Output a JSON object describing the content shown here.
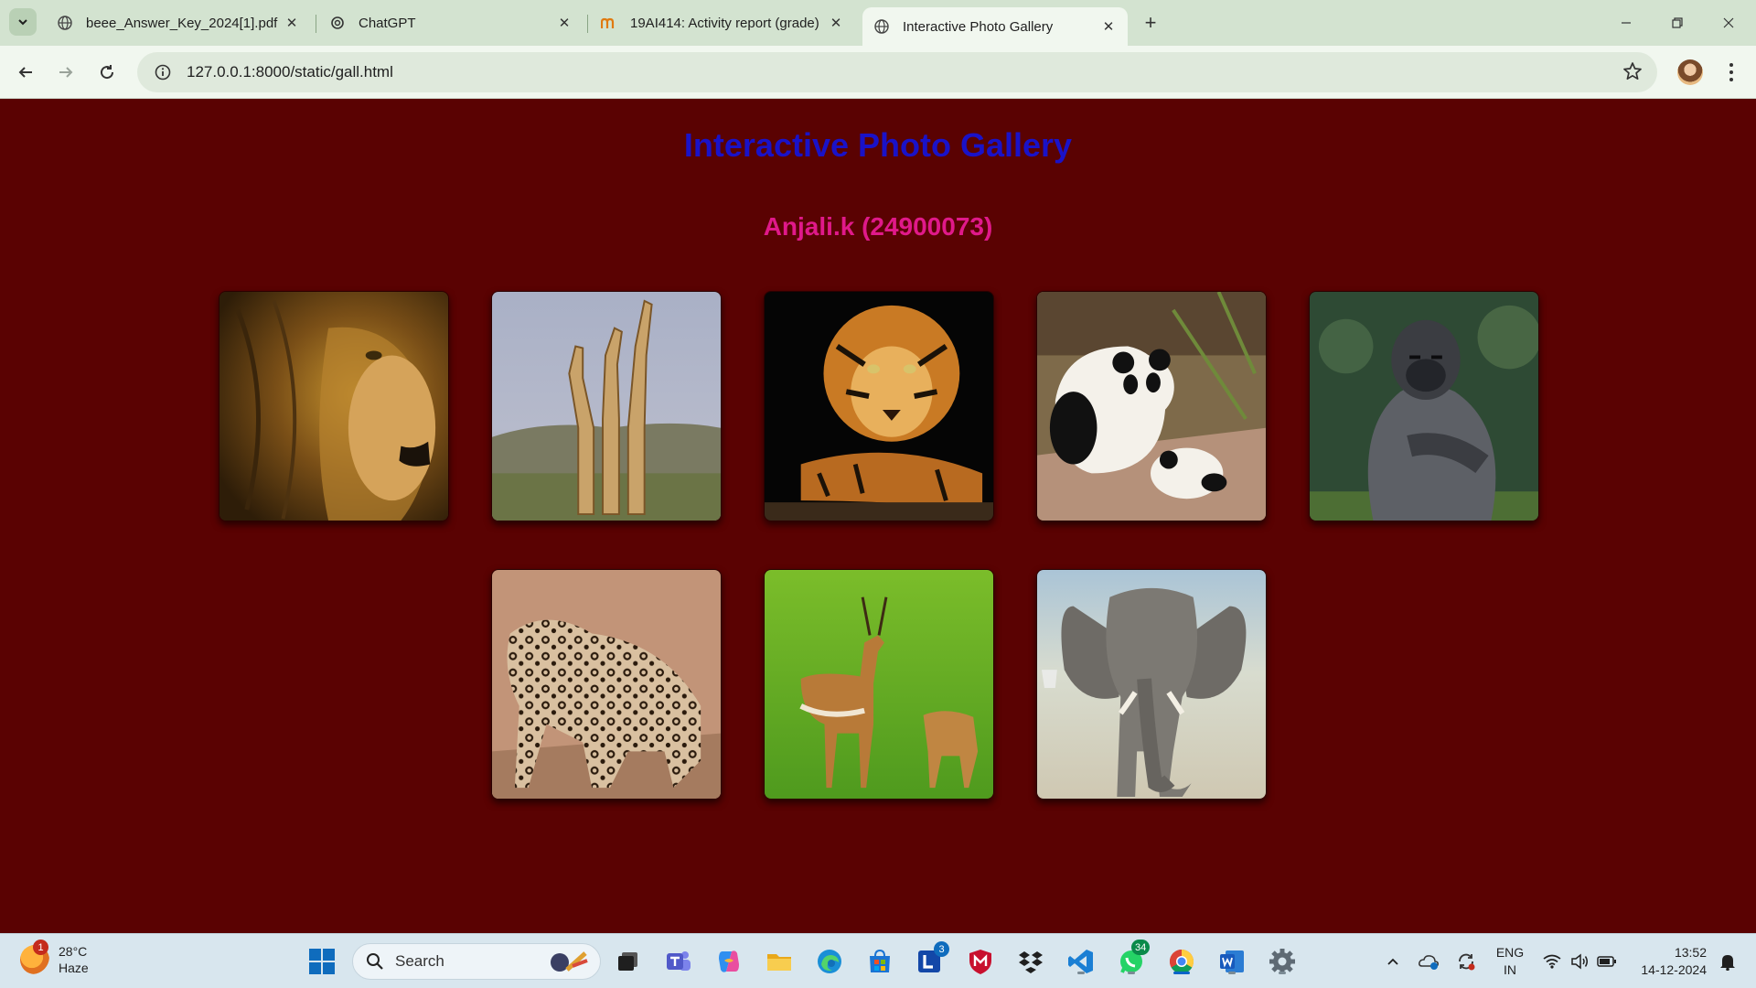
{
  "browser": {
    "tabs": [
      {
        "title": "beee_Answer_Key_2024[1].pdf",
        "icon": "globe-icon"
      },
      {
        "title": "ChatGPT",
        "icon": "chatgpt-icon"
      },
      {
        "title": "19AI414: Activity report (grade)",
        "icon": "moodle-icon"
      },
      {
        "title": "Interactive Photo Gallery",
        "icon": "globe-icon",
        "active": true
      }
    ],
    "url": "127.0.0.1:8000/static/gall.html"
  },
  "page": {
    "title": "Interactive Photo Gallery",
    "subtitle": "Anjali.k (24900073)",
    "background": "#5a0202",
    "title_color": "#1a12c8",
    "subtitle_color": "#e0198a",
    "gallery": [
      {
        "animal": "lion"
      },
      {
        "animal": "giraffes"
      },
      {
        "animal": "tiger"
      },
      {
        "animal": "pandas"
      },
      {
        "animal": "gorilla"
      },
      {
        "animal": "leopard"
      },
      {
        "animal": "impala"
      },
      {
        "animal": "elephant"
      }
    ]
  },
  "taskbar": {
    "weather": {
      "temp": "28°C",
      "condition": "Haze",
      "badge": "1"
    },
    "search_placeholder": "Search",
    "badges": {
      "teams_l": "3",
      "whatsapp": "34"
    },
    "language": {
      "line1": "ENG",
      "line2": "IN"
    },
    "time": "13:52",
    "date": "14-12-2024"
  }
}
